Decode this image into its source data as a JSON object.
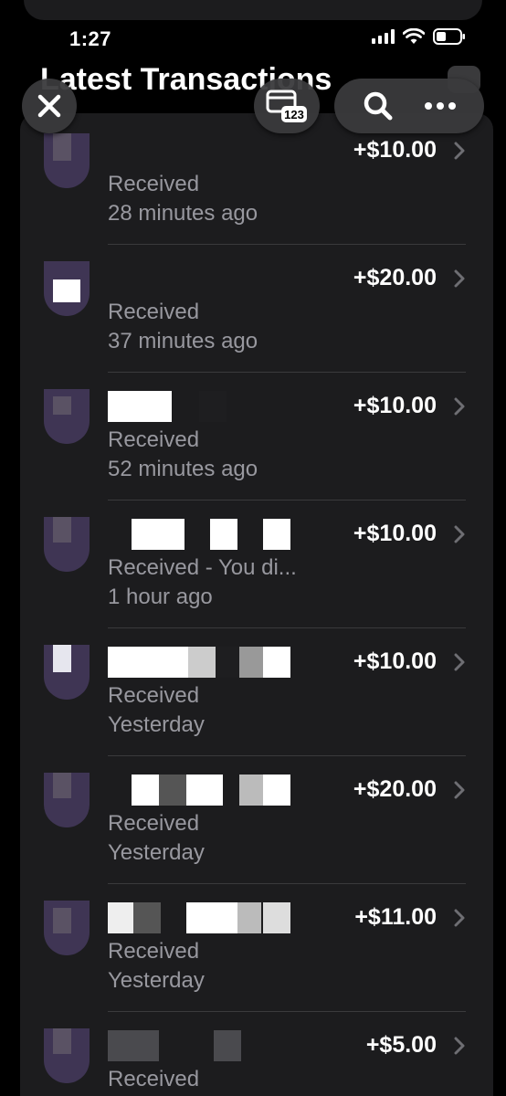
{
  "status_bar": {
    "time": "1:27"
  },
  "header": {
    "title": "Latest Transactions"
  },
  "toolbar": {
    "close_icon": "close-icon",
    "card_icon": "card-123-icon",
    "card_badge": "123",
    "search_icon": "search-icon",
    "more_icon": "ellipsis-icon"
  },
  "transactions": [
    {
      "amount": "+$10.00",
      "status": "Received",
      "time": "28 minutes ago"
    },
    {
      "amount": "+$20.00",
      "status": "Received",
      "time": "37 minutes ago"
    },
    {
      "amount": "+$10.00",
      "status": "Received",
      "time": "52 minutes ago"
    },
    {
      "amount": "+$10.00",
      "status": "Received - You di...",
      "time": "1 hour ago"
    },
    {
      "amount": "+$10.00",
      "status": "Received",
      "time": "Yesterday"
    },
    {
      "amount": "+$20.00",
      "status": "Received",
      "time": "Yesterday"
    },
    {
      "amount": "+$11.00",
      "status": "Received",
      "time": "Yesterday"
    },
    {
      "amount": "+$5.00",
      "status": "Received",
      "time": ""
    }
  ],
  "colors": {
    "background": "#000000",
    "panel": "#1c1c1e",
    "secondary_text": "#98989f",
    "avatar": "#3f3554"
  }
}
